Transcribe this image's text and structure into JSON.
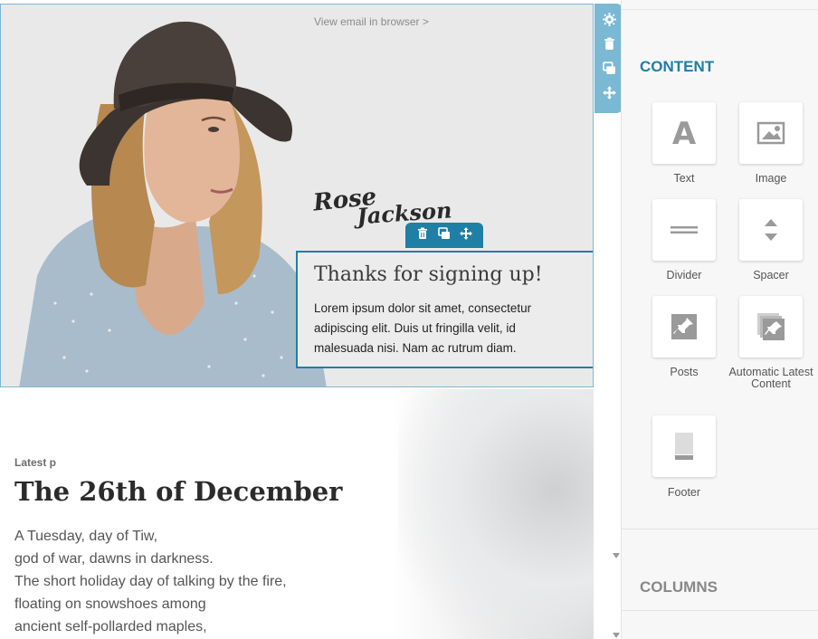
{
  "hero": {
    "view_link": "View email in browser >",
    "signature_text": "Rose Jackson",
    "text_block": {
      "title": "Thanks for signing up!",
      "body": "Lorem ipsum dolor sit amet, consectetur adipiscing elit. Duis ut fringilla velit, id malesuada nisi. Nam ac rutrum diam."
    }
  },
  "post": {
    "eyebrow": "Latest p",
    "title": "The 26th of December",
    "lines": [
      "A Tuesday, day of Tiw,",
      "god of war, dawns in darkness.",
      "The short holiday day of talking by the fire,",
      "floating on snowshoes among",
      "ancient self-pollarded maples,"
    ]
  },
  "block_toolbar": {
    "icons": [
      "trash-icon",
      "duplicate-icon",
      "move-icon"
    ]
  },
  "side_toolbar": {
    "icons": [
      "gear-icon",
      "trash-icon",
      "duplicate-icon",
      "move-icon"
    ]
  },
  "sidebar": {
    "content_heading": "CONTENT",
    "blocks": [
      {
        "label": "Text",
        "icon": "text-icon"
      },
      {
        "label": "Image",
        "icon": "image-icon"
      },
      {
        "label": "Divider",
        "icon": "divider-icon"
      },
      {
        "label": "Spacer",
        "icon": "spacer-icon"
      },
      {
        "label": "Posts",
        "icon": "posts-icon"
      },
      {
        "label": "Automatic Latest Content",
        "icon": "alc-icon"
      },
      {
        "label": "Footer",
        "icon": "footer-icon"
      }
    ],
    "columns_heading": "COLUMNS"
  },
  "colors": {
    "accent": "#1f7fa5",
    "toolbar_light": "#7ab8d4",
    "sidebar_bg": "#f7f7f7"
  }
}
